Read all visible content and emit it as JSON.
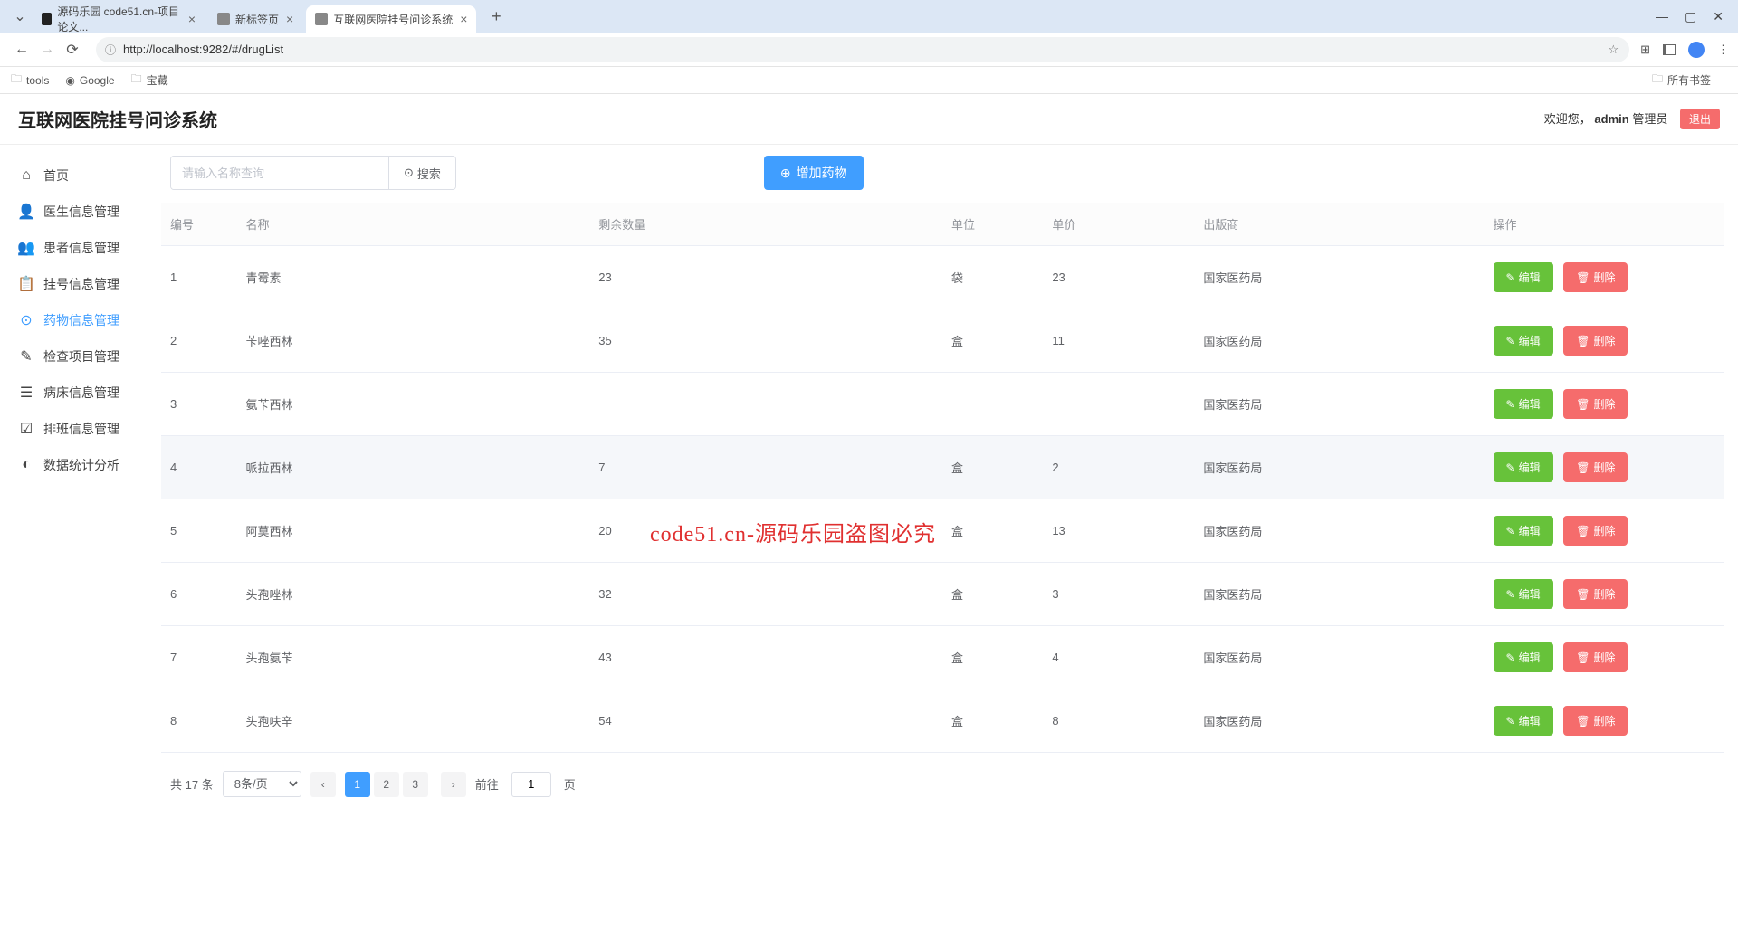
{
  "browser": {
    "tabs": [
      {
        "title": "源码乐园 code51.cn-项目论文..."
      },
      {
        "title": "新标签页"
      },
      {
        "title": "互联网医院挂号问诊系统"
      }
    ],
    "url": "http://localhost:9282/#/drugList",
    "bookmarks": {
      "tools": "tools",
      "google": "Google",
      "baozang": "宝藏",
      "all": "所有书签"
    }
  },
  "header": {
    "title": "互联网医院挂号问诊系统",
    "welcome": "欢迎您，",
    "username": "admin",
    "role": "管理员",
    "logout": "退出"
  },
  "sidebar": {
    "items": [
      {
        "label": "首页",
        "icon": "home"
      },
      {
        "label": "医生信息管理",
        "icon": "doctor"
      },
      {
        "label": "患者信息管理",
        "icon": "patient"
      },
      {
        "label": "挂号信息管理",
        "icon": "register"
      },
      {
        "label": "药物信息管理",
        "icon": "drug",
        "active": true
      },
      {
        "label": "检查项目管理",
        "icon": "check"
      },
      {
        "label": "病床信息管理",
        "icon": "bed"
      },
      {
        "label": "排班信息管理",
        "icon": "schedule"
      },
      {
        "label": "数据统计分析",
        "icon": "stat"
      }
    ]
  },
  "toolbar": {
    "search_placeholder": "请输入名称查询",
    "search_label": "搜索",
    "add_label": "增加药物"
  },
  "table": {
    "headers": {
      "id": "编号",
      "name": "名称",
      "qty": "剩余数量",
      "unit": "单位",
      "price": "单价",
      "publisher": "出版商",
      "op": "操作"
    },
    "edit_label": "编辑",
    "delete_label": "删除",
    "rows": [
      {
        "id": "1",
        "name": "青霉素",
        "qty": "23",
        "unit": "袋",
        "price": "23",
        "publisher": "国家医药局"
      },
      {
        "id": "2",
        "name": "苄唑西林",
        "qty": "35",
        "unit": "盒",
        "price": "11",
        "publisher": "国家医药局"
      },
      {
        "id": "3",
        "name": "氨苄西林",
        "qty": "",
        "unit": "",
        "price": "",
        "publisher": "国家医药局"
      },
      {
        "id": "4",
        "name": "哌拉西林",
        "qty": "7",
        "unit": "盒",
        "price": "2",
        "publisher": "国家医药局",
        "hover": true
      },
      {
        "id": "5",
        "name": "阿莫西林",
        "qty": "20",
        "unit": "盒",
        "price": "13",
        "publisher": "国家医药局"
      },
      {
        "id": "6",
        "name": "头孢唑林",
        "qty": "32",
        "unit": "盒",
        "price": "3",
        "publisher": "国家医药局"
      },
      {
        "id": "7",
        "name": "头孢氨苄",
        "qty": "43",
        "unit": "盒",
        "price": "4",
        "publisher": "国家医药局"
      },
      {
        "id": "8",
        "name": "头孢呋辛",
        "qty": "54",
        "unit": "盒",
        "price": "8",
        "publisher": "国家医药局"
      }
    ]
  },
  "pagination": {
    "total_prefix": "共",
    "total_count": "17",
    "total_suffix": "条",
    "page_size": "8条/页",
    "pages": [
      "1",
      "2",
      "3"
    ],
    "active_page": "1",
    "goto_prefix": "前往",
    "goto_value": "1",
    "goto_suffix": "页"
  },
  "watermark": "code51.cn-源码乐园盗图必究"
}
